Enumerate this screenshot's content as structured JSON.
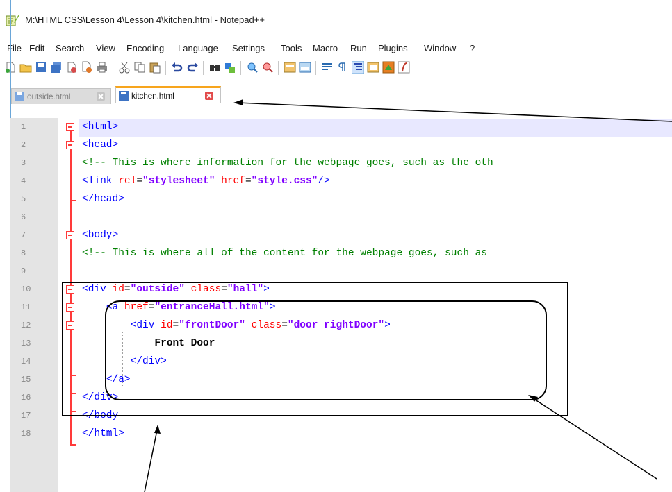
{
  "window": {
    "title": "M:\\HTML CSS\\Lesson 4\\Lesson 4\\kitchen.html - Notepad++"
  },
  "menu": {
    "items": [
      "File",
      "Edit",
      "Search",
      "View",
      "Encoding",
      "Language",
      "Settings",
      "Tools",
      "Macro",
      "Run",
      "Plugins",
      "Window",
      "?"
    ]
  },
  "toolbar": {
    "buttons": [
      "new-file-icon",
      "open-file-icon",
      "save-icon",
      "save-all-icon",
      "close-icon",
      "close-all-icon",
      "print-icon",
      "cut-icon",
      "copy-icon",
      "paste-icon",
      "undo-icon",
      "redo-icon",
      "find-icon",
      "replace-icon",
      "zoom-in-icon",
      "zoom-out-icon",
      "sync-vertical-icon",
      "sync-horizontal-icon",
      "word-wrap-icon",
      "show-all-chars-icon",
      "indent-guide-icon",
      "user-language-icon",
      "document-map-icon",
      "function-list-icon"
    ]
  },
  "tabs": [
    {
      "label": "outside.html",
      "active": false
    },
    {
      "label": "kitchen.html",
      "active": true
    }
  ],
  "editor": {
    "line_numbers": [
      "1",
      "2",
      "3",
      "4",
      "5",
      "6",
      "7",
      "8",
      "9",
      "10",
      "11",
      "12",
      "13",
      "14",
      "15",
      "16",
      "17",
      "18"
    ],
    "lines": [
      [
        {
          "t": "tag",
          "v": "<html>"
        }
      ],
      [
        {
          "t": "tag",
          "v": "<head>"
        }
      ],
      [
        {
          "t": "comment",
          "v": "<!-- This is where information for the webpage goes, such as the oth"
        }
      ],
      [
        {
          "t": "tag",
          "v": "<link "
        },
        {
          "t": "attr",
          "v": "rel"
        },
        {
          "t": "misc",
          "v": "="
        },
        {
          "t": "val",
          "v": "\"stylesheet\""
        },
        {
          "t": "attr",
          "v": " href"
        },
        {
          "t": "misc",
          "v": "="
        },
        {
          "t": "val",
          "v": "\"style.css\""
        },
        {
          "t": "tag",
          "v": "/>"
        }
      ],
      [
        {
          "t": "tag",
          "v": "</head>"
        }
      ],
      [],
      [
        {
          "t": "tag",
          "v": "<body>"
        }
      ],
      [
        {
          "t": "comment",
          "v": "<!-- This is where all of the content for the webpage goes, such as"
        }
      ],
      [],
      [
        {
          "t": "tag",
          "v": "<div "
        },
        {
          "t": "attr",
          "v": "id"
        },
        {
          "t": "misc",
          "v": "="
        },
        {
          "t": "val",
          "v": "\"outside\""
        },
        {
          "t": "attr",
          "v": " class"
        },
        {
          "t": "misc",
          "v": "="
        },
        {
          "t": "val",
          "v": "\"hall\""
        },
        {
          "t": "tag",
          "v": ">"
        }
      ],
      [
        {
          "t": "misc",
          "v": "    "
        },
        {
          "t": "tag",
          "v": "<a "
        },
        {
          "t": "attr",
          "v": "href"
        },
        {
          "t": "misc",
          "v": "="
        },
        {
          "t": "val",
          "v": "\"entranceHall.html\""
        },
        {
          "t": "tag",
          "v": ">"
        }
      ],
      [
        {
          "t": "misc",
          "v": "        "
        },
        {
          "t": "tag",
          "v": "<div "
        },
        {
          "t": "attr",
          "v": "id"
        },
        {
          "t": "misc",
          "v": "="
        },
        {
          "t": "val",
          "v": "\"frontDoor\""
        },
        {
          "t": "attr",
          "v": " class"
        },
        {
          "t": "misc",
          "v": "="
        },
        {
          "t": "val",
          "v": "\"door rightDoor\""
        },
        {
          "t": "tag",
          "v": ">"
        }
      ],
      [
        {
          "t": "misc",
          "v": "            "
        },
        {
          "t": "text",
          "v": "Front Door"
        }
      ],
      [
        {
          "t": "misc",
          "v": "        "
        },
        {
          "t": "tag",
          "v": "</div>"
        }
      ],
      [
        {
          "t": "misc",
          "v": "    "
        },
        {
          "t": "tag",
          "v": "</a>"
        }
      ],
      [
        {
          "t": "tag",
          "v": "</div>"
        }
      ],
      [
        {
          "t": "tag",
          "v": "</body"
        }
      ],
      [
        {
          "t": "tag",
          "v": "</html>"
        }
      ]
    ]
  },
  "colors": {
    "tag": "#0000ff",
    "attr": "#ff0000",
    "value": "#8000ff",
    "comment": "#008000",
    "fold": "#ff3a3a",
    "active_tab_accent": "#f7a51d"
  }
}
